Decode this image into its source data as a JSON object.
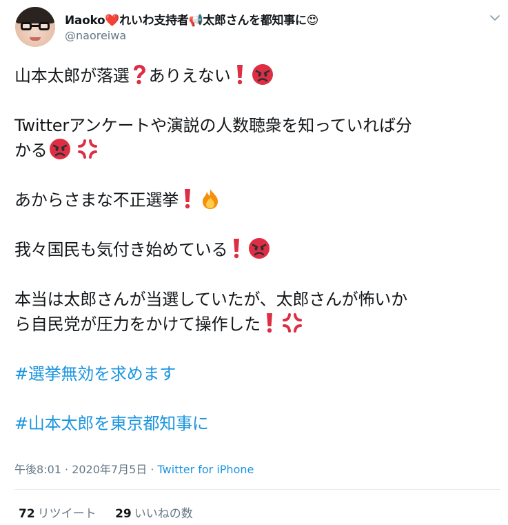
{
  "tweet": {
    "display_name": "Иaoko❤️れいわ支持者📢太郎さんを都知事に😍",
    "handle": "@naoreiwa",
    "paragraphs": {
      "p1": "山本太郎が落選",
      "p1b": "ありえない",
      "p2_line1": "Twitterアンケートや演説の人数聴衆を知っていれば分",
      "p2_line2": "かる",
      "p3": "あからさまな不正選挙",
      "p4": "我々国民も気付き始めている",
      "p5_line1": "本当は太郎さんが当選していたが、太郎さんが怖いか",
      "p5_line2": "ら自民党が圧力をかけて操作した",
      "hashtag1": "#選挙無効を求めます",
      "hashtag2": "#山本太郎を東京都知事に"
    },
    "time": "午後8:01 · 2020年7月5日 · ",
    "source": "Twitter for iPhone",
    "retweets_count": "72",
    "retweets_label": "リツイート",
    "likes_count": "29",
    "likes_label": "いいねの数"
  },
  "icons": {
    "caret": "chevron-down-icon",
    "question": "red-question-mark-emoji",
    "exclamation": "red-exclamation-mark-emoji",
    "angry": "pouting-face-emoji",
    "anger": "anger-symbol-emoji",
    "fire": "fire-emoji"
  },
  "colors": {
    "text": "#14171a",
    "muted": "#657786",
    "link": "#1b95e0",
    "divider": "#e6ecf0",
    "emoji_red": "#e0314b"
  }
}
